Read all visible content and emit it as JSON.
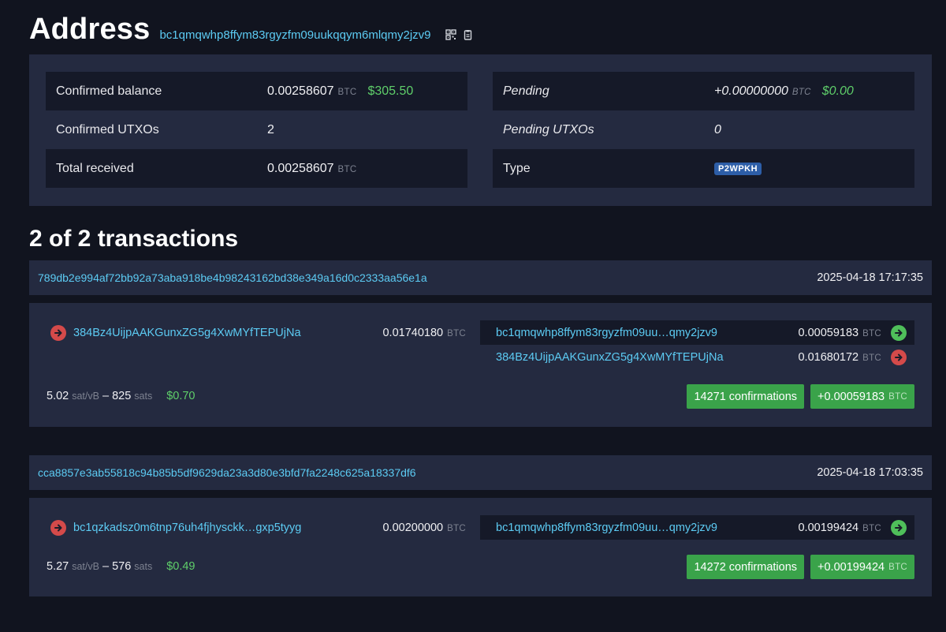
{
  "header": {
    "title": "Address",
    "address": "bc1qmqwhp8ffym83rgyzfm09uukqqym6mlqmy2jzv9"
  },
  "summary": {
    "confirmed_balance": {
      "label": "Confirmed balance",
      "value": "0.00258607",
      "unit": "BTC",
      "fiat": "$305.50"
    },
    "confirmed_utxos": {
      "label": "Confirmed UTXOs",
      "value": "2"
    },
    "total_received": {
      "label": "Total received",
      "value": "0.00258607",
      "unit": "BTC"
    },
    "pending": {
      "label": "Pending",
      "value": "+0.00000000",
      "unit": "BTC",
      "fiat": "$0.00"
    },
    "pending_utxos": {
      "label": "Pending UTXOs",
      "value": "0"
    },
    "type": {
      "label": "Type",
      "value": "P2WPKH"
    }
  },
  "transactions_heading": "2 of 2 transactions",
  "transactions": [
    {
      "txid": "789db2e994af72bb92a73aba918be4b98243162bd38e349a16d0c2333aa56e1a",
      "time": "2025-04-18 17:17:35",
      "input": {
        "address": "384Bz4UijpAAKGunxZG5g4XwMYfTEPUjNa",
        "amount": "0.01740180",
        "unit": "BTC"
      },
      "outputs": [
        {
          "address": "bc1qmqwhp8ffym83rgyzfm09uu…qmy2jzv9",
          "amount": "0.00059183",
          "unit": "BTC",
          "direction": "in"
        },
        {
          "address": "384Bz4UijpAAKGunxZG5g4XwMYfTEPUjNa",
          "amount": "0.01680172",
          "unit": "BTC",
          "direction": "out"
        }
      ],
      "fee_rate": "5.02",
      "fee_rate_unit": "sat/vB",
      "fee_sats": "825",
      "fee_sats_unit": "sats",
      "fee_fiat": "$0.70",
      "confirmations": "14271 confirmations",
      "net": "+0.00059183",
      "net_unit": "BTC"
    },
    {
      "txid": "cca8857e3ab55818c94b85b5df9629da23a3d80e3bfd7fa2248c625a18337df6",
      "time": "2025-04-18 17:03:35",
      "input": {
        "address": "bc1qzkadsz0m6tnp76uh4fjhysckk…gxp5tyyg",
        "amount": "0.00200000",
        "unit": "BTC"
      },
      "outputs": [
        {
          "address": "bc1qmqwhp8ffym83rgyzfm09uu…qmy2jzv9",
          "amount": "0.00199424",
          "unit": "BTC",
          "direction": "in"
        }
      ],
      "fee_rate": "5.27",
      "fee_rate_unit": "sat/vB",
      "fee_sats": "576",
      "fee_sats_unit": "sats",
      "fee_fiat": "$0.49",
      "confirmations": "14272 confirmations",
      "net": "+0.00199424",
      "net_unit": "BTC"
    }
  ],
  "icons": {
    "qr": "qr-code-icon",
    "copy": "copy-icon",
    "arrow_red": "arrow-right-circle-icon",
    "arrow_green": "arrow-right-circle-icon"
  },
  "colors": {
    "accent_link": "#5ccbf3",
    "fiat_green": "#5fcf6a",
    "button_green": "#3aa34a",
    "badge_blue": "#2d5ea8",
    "arrow_red": "#d44a4a",
    "arrow_green": "#4fbf5a"
  }
}
